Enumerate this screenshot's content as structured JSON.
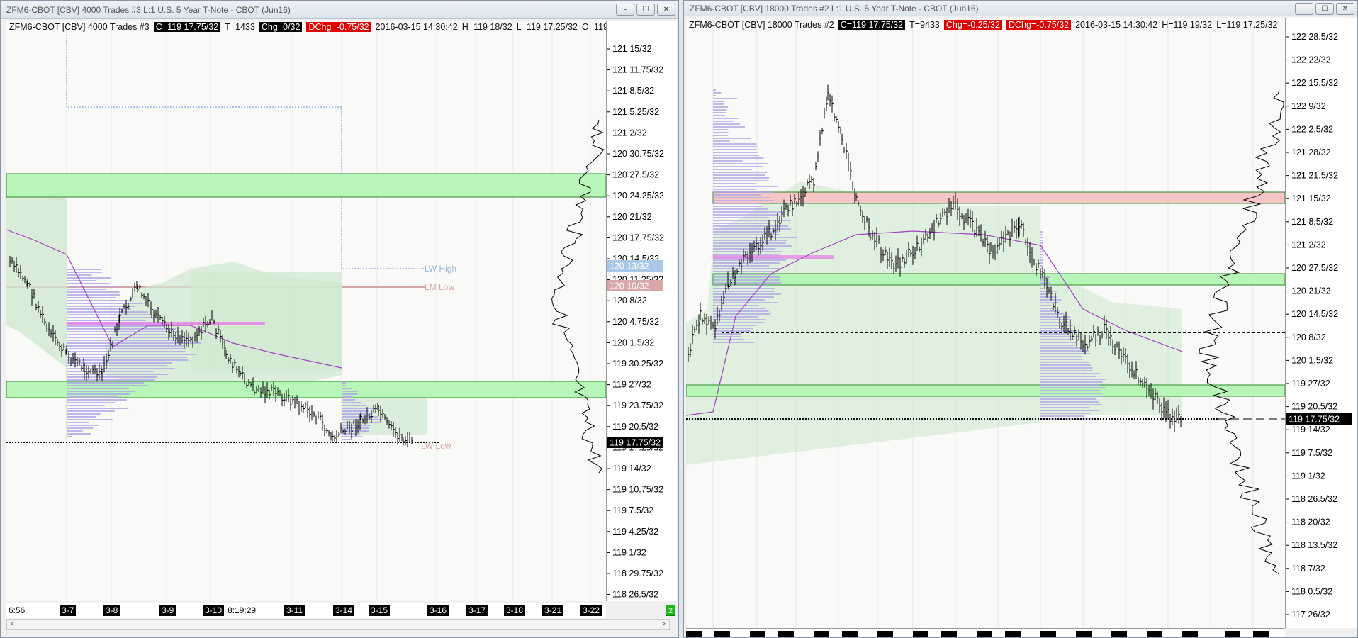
{
  "colors": {
    "zone_green": "#b8f5b8",
    "zone_red": "#f6c6c6",
    "profile_purple": "#b3a9e6",
    "value_area_green": "#cfe9cf",
    "vwap": "#a040c0",
    "last_price_label": "#000000",
    "change_red": "#e00000"
  },
  "left_window": {
    "title": "ZFM6-CBOT [CBV]  4000 Trades  #3  L:1  U.S. 5 Year T-Note - CBOT (Jun16)",
    "buttons": {
      "minimize": "–",
      "maximize": "☐",
      "close": "✕"
    },
    "info": {
      "symbol": "ZFM6-CBOT [CBV]  4000 Trades  #3",
      "close": "C=119 17.75/32",
      "trades": "T=1433",
      "chg": "Chg=0/32",
      "dchg": "DChg=-0.75/32",
      "datetime": "2016-03-15 14:30:42",
      "high": "H=119 18/32",
      "low": "L=119 17.25/32",
      "open": "O=119"
    },
    "price_labels": [
      "121 15/32",
      "121 11.75/32",
      "121 8.5/32",
      "121 5.25/32",
      "121 2/32",
      "120 30.75/32",
      "120 27.5/32",
      "120 24.25/32",
      "120 21/32",
      "120 17.75/32",
      "120 14.5/32",
      "120 11.25/32",
      "120 8/32",
      "120 4.75/32",
      "120 1.5/32",
      "119 30.25/32",
      "119 27/32",
      "119 23.75/32",
      "119 20.5/32",
      "119 17.25/32",
      "119 14/32",
      "119 10.75/32",
      "119 7.5/32",
      "119 4.25/32",
      "119 1/32",
      "118 29.75/32",
      "118 26.5/32"
    ],
    "highlight_labels": {
      "lw_high_value": "120 13/32",
      "lm_low_value": "120 10/32",
      "last": "119 17.75/32"
    },
    "annotations": {
      "lw_high": "LW High",
      "lm_low": "LM Low",
      "lw_low": "LW Low"
    },
    "time_labels": [
      "6:56",
      "3-7",
      "3-8",
      "3-9",
      "3-10",
      "8:19:29",
      "3-11",
      "3-14",
      "3-15",
      "3-16",
      "3-17",
      "3-18",
      "3-21",
      "3-22"
    ],
    "status_badge": "2",
    "scroll": {
      "left": "<",
      "right": ">"
    }
  },
  "right_window": {
    "title": "ZFM6-CBOT [CBV]  18000 Trades  #2  L:1  U.S. 5 Year T-Note - CBOT (Jun16)",
    "buttons": {
      "minimize": "–",
      "maximize": "☐",
      "close": "✕"
    },
    "info": {
      "symbol": "ZFM6-CBOT [CBV]  18000 Trades  #2",
      "close": "C=119 17.75/32",
      "trades": "T=9433",
      "chg": "Chg=-0.25/32",
      "dchg": "DChg=-0.75/32",
      "datetime": "2016-03-15 14:30:42",
      "high": "H=119 19/32",
      "low": "L=119 17.25/32"
    },
    "price_labels": [
      "122 28.5/32",
      "122 22/32",
      "122 15.5/32",
      "122 9/32",
      "122 2.5/32",
      "121 28/32",
      "121 21.5/32",
      "121 15/32",
      "121 8.5/32",
      "121 2/32",
      "120 27.5/32",
      "120 21/32",
      "120 14.5/32",
      "120 8/32",
      "120 1.5/32",
      "119 27/32",
      "119 20.5/32",
      "119 14/32",
      "119 7.5/32",
      "119 1/32",
      "118 26.5/32",
      "118 20/32",
      "118 13.5/32",
      "118 7/32",
      "118 0.5/32",
      "117 26/32"
    ],
    "last_label": "119 17.75/32"
  }
}
